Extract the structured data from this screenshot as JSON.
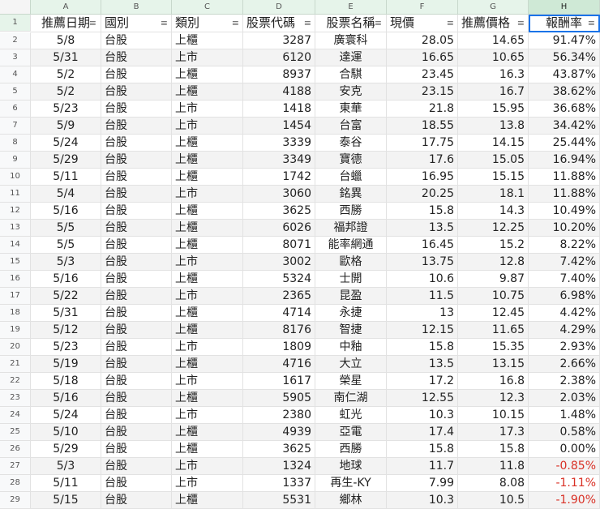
{
  "columns": [
    "A",
    "B",
    "C",
    "D",
    "E",
    "F",
    "G",
    "H"
  ],
  "headers": [
    "推薦日期",
    "國別",
    "類別",
    "股票代碼",
    "股票名稱",
    "現價",
    "推薦價格",
    "報酬率"
  ],
  "filter_icon": "filter-icon",
  "negative_color": "#d93025",
  "rows": [
    [
      "5/8",
      "台股",
      "上櫃",
      "3287",
      "廣寰科",
      "28.05",
      "14.65",
      "91.47%"
    ],
    [
      "5/31",
      "台股",
      "上市",
      "6120",
      "達運",
      "16.65",
      "10.65",
      "56.34%"
    ],
    [
      "5/2",
      "台股",
      "上櫃",
      "8937",
      "合騏",
      "23.45",
      "16.3",
      "43.87%"
    ],
    [
      "5/2",
      "台股",
      "上櫃",
      "4188",
      "安克",
      "23.15",
      "16.7",
      "38.62%"
    ],
    [
      "5/23",
      "台股",
      "上市",
      "1418",
      "東華",
      "21.8",
      "15.95",
      "36.68%"
    ],
    [
      "5/9",
      "台股",
      "上市",
      "1454",
      "台富",
      "18.55",
      "13.8",
      "34.42%"
    ],
    [
      "5/24",
      "台股",
      "上櫃",
      "3339",
      "泰谷",
      "17.75",
      "14.15",
      "25.44%"
    ],
    [
      "5/29",
      "台股",
      "上櫃",
      "3349",
      "寶德",
      "17.6",
      "15.05",
      "16.94%"
    ],
    [
      "5/11",
      "台股",
      "上櫃",
      "1742",
      "台蠟",
      "16.95",
      "15.15",
      "11.88%"
    ],
    [
      "5/4",
      "台股",
      "上市",
      "3060",
      "銘異",
      "20.25",
      "18.1",
      "11.88%"
    ],
    [
      "5/16",
      "台股",
      "上櫃",
      "3625",
      "西勝",
      "15.8",
      "14.3",
      "10.49%"
    ],
    [
      "5/5",
      "台股",
      "上櫃",
      "6026",
      "福邦證",
      "13.5",
      "12.25",
      "10.20%"
    ],
    [
      "5/5",
      "台股",
      "上櫃",
      "8071",
      "能率網通",
      "16.45",
      "15.2",
      "8.22%"
    ],
    [
      "5/3",
      "台股",
      "上市",
      "3002",
      "歐格",
      "13.75",
      "12.8",
      "7.42%"
    ],
    [
      "5/16",
      "台股",
      "上櫃",
      "5324",
      "士開",
      "10.6",
      "9.87",
      "7.40%"
    ],
    [
      "5/22",
      "台股",
      "上市",
      "2365",
      "昆盈",
      "11.5",
      "10.75",
      "6.98%"
    ],
    [
      "5/31",
      "台股",
      "上櫃",
      "4714",
      "永捷",
      "13",
      "12.45",
      "4.42%"
    ],
    [
      "5/12",
      "台股",
      "上櫃",
      "8176",
      "智捷",
      "12.15",
      "11.65",
      "4.29%"
    ],
    [
      "5/23",
      "台股",
      "上市",
      "1809",
      "中釉",
      "15.8",
      "15.35",
      "2.93%"
    ],
    [
      "5/19",
      "台股",
      "上櫃",
      "4716",
      "大立",
      "13.5",
      "13.15",
      "2.66%"
    ],
    [
      "5/18",
      "台股",
      "上市",
      "1617",
      "榮星",
      "17.2",
      "16.8",
      "2.38%"
    ],
    [
      "5/16",
      "台股",
      "上櫃",
      "5905",
      "南仁湖",
      "12.55",
      "12.3",
      "2.03%"
    ],
    [
      "5/24",
      "台股",
      "上市",
      "2380",
      "虹光",
      "10.3",
      "10.15",
      "1.48%"
    ],
    [
      "5/10",
      "台股",
      "上櫃",
      "4939",
      "亞電",
      "17.4",
      "17.3",
      "0.58%"
    ],
    [
      "5/29",
      "台股",
      "上櫃",
      "3625",
      "西勝",
      "15.8",
      "15.8",
      "0.00%"
    ],
    [
      "5/3",
      "台股",
      "上市",
      "1324",
      "地球",
      "11.7",
      "11.8",
      "-0.85%"
    ],
    [
      "5/11",
      "台股",
      "上市",
      "1337",
      "再生-KY",
      "7.99",
      "8.08",
      "-1.11%"
    ],
    [
      "5/15",
      "台股",
      "上櫃",
      "5531",
      "鄉林",
      "10.3",
      "10.5",
      "-1.90%"
    ]
  ]
}
